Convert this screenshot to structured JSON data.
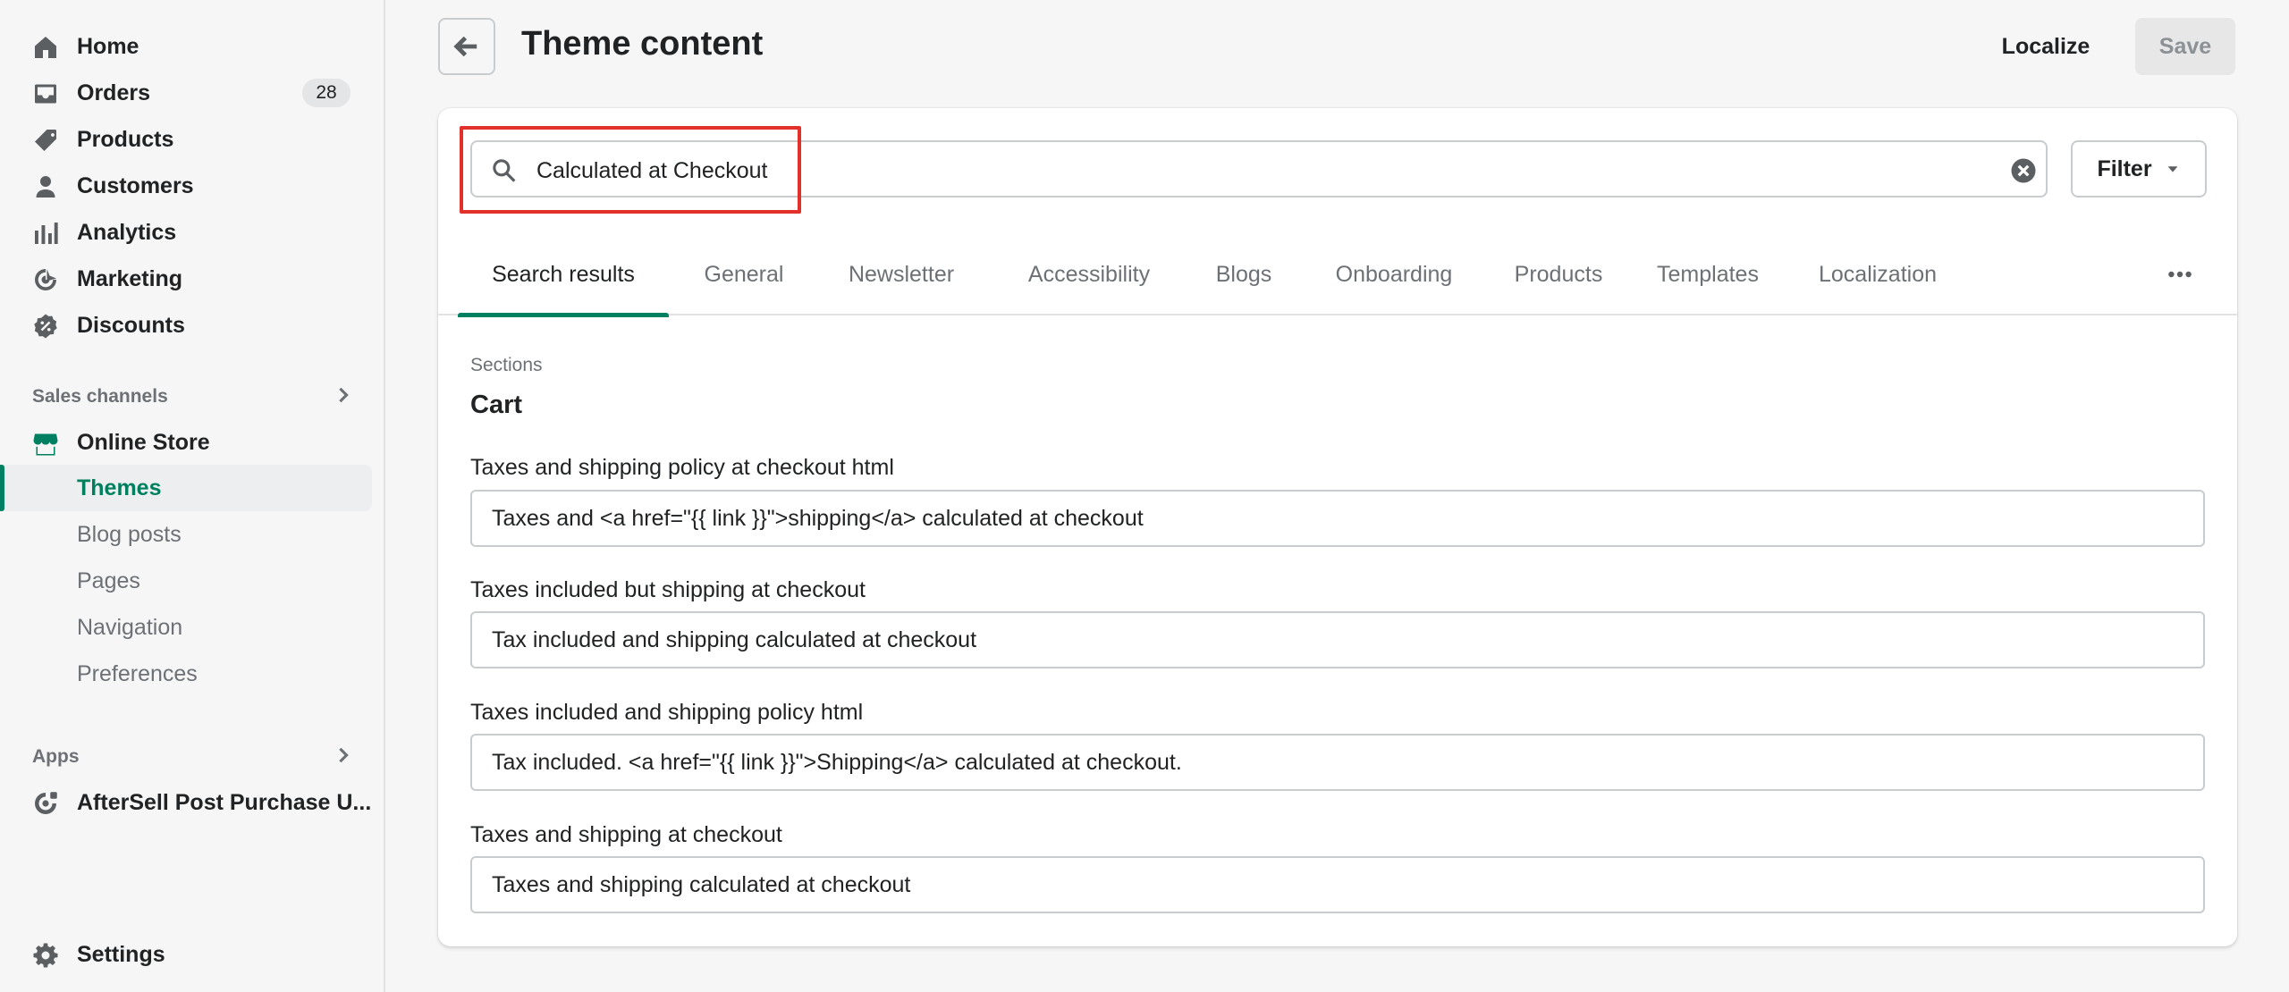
{
  "sidebar": {
    "main_items": [
      {
        "label": "Home",
        "icon": "home-icon"
      },
      {
        "label": "Orders",
        "icon": "inbox-icon",
        "badge": "28"
      },
      {
        "label": "Products",
        "icon": "tag-icon"
      },
      {
        "label": "Customers",
        "icon": "person-icon"
      },
      {
        "label": "Analytics",
        "icon": "bar-chart-icon"
      },
      {
        "label": "Marketing",
        "icon": "target-icon"
      },
      {
        "label": "Discounts",
        "icon": "discount-icon"
      }
    ],
    "sales_channels_heading": "Sales channels",
    "online_store": {
      "label": "Online Store",
      "icon": "store-icon"
    },
    "online_store_sub": [
      {
        "label": "Themes",
        "selected": true
      },
      {
        "label": "Blog posts"
      },
      {
        "label": "Pages"
      },
      {
        "label": "Navigation"
      },
      {
        "label": "Preferences"
      }
    ],
    "apps_heading": "Apps",
    "app_item": {
      "label": "AfterSell Post Purchase U...",
      "icon": "app-icon"
    },
    "settings": {
      "label": "Settings",
      "icon": "gear-icon"
    }
  },
  "header": {
    "title": "Theme content",
    "localize_label": "Localize",
    "save_label": "Save"
  },
  "search": {
    "value": "Calculated at Checkout",
    "filter_label": "Filter"
  },
  "tabs": [
    {
      "label": "Search results",
      "active": true
    },
    {
      "label": "General"
    },
    {
      "label": "Newsletter"
    },
    {
      "label": "Accessibility"
    },
    {
      "label": "Blogs"
    },
    {
      "label": "Onboarding"
    },
    {
      "label": "Products"
    },
    {
      "label": "Templates"
    },
    {
      "label": "Localization"
    }
  ],
  "results": {
    "section_label": "Sections",
    "section_title": "Cart",
    "fields": [
      {
        "label": "Taxes and shipping policy at checkout html",
        "value": "Taxes and <a href=\"{{ link }}\">shipping</a> calculated at checkout"
      },
      {
        "label": "Taxes included but shipping at checkout",
        "value": "Tax included and shipping calculated at checkout"
      },
      {
        "label": "Taxes included and shipping policy html",
        "value": "Tax included. <a href=\"{{ link }}\">Shipping</a> calculated at checkout."
      },
      {
        "label": "Taxes and shipping at checkout",
        "value": "Taxes and shipping calculated at checkout"
      }
    ]
  },
  "colors": {
    "accent": "#008060",
    "highlight_box": "#e1312a",
    "background": "#f6f6f7"
  }
}
